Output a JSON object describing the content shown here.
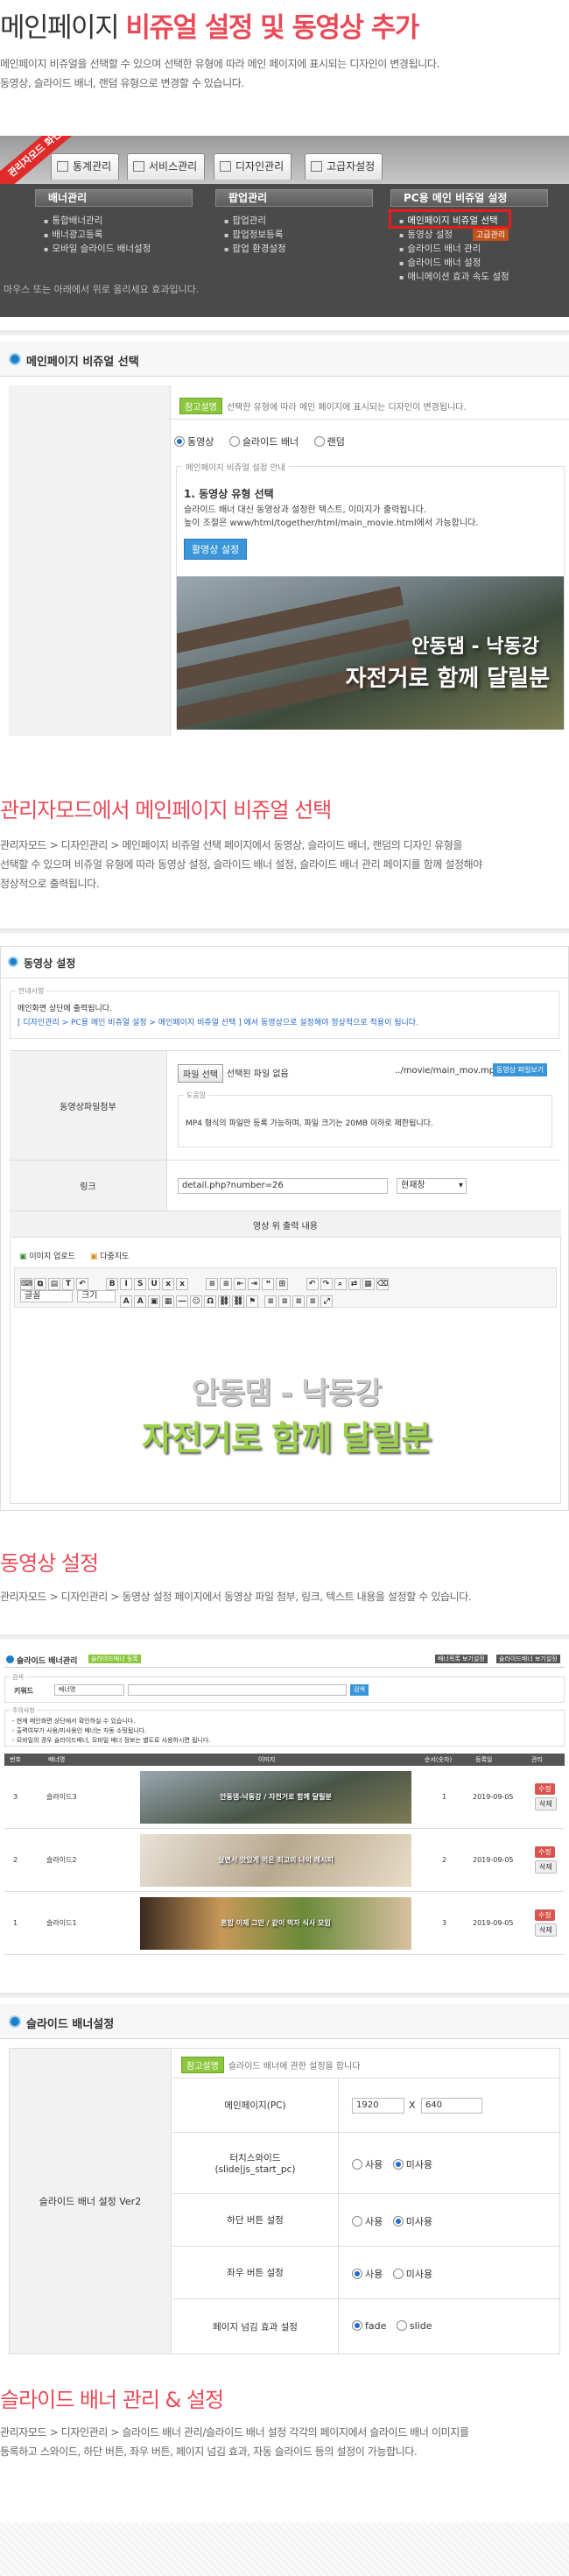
{
  "header": {
    "title_a": "메인페이지 ",
    "title_b": "비쥬얼 설정 및 동영상 추가",
    "desc1": "메인페이지 비쥬얼을 선택할 수 있으며 선택한 유형에 따라 메인 페이지에 표시되는 디자인이 변경됩니다.",
    "desc2": "동영상, 슬라이드 배너, 랜덤 유형으로 변경할 수 있습니다."
  },
  "menu_shot": {
    "badge": "관리자모드 화면",
    "tabs": [
      "통계관리",
      "서비스관리",
      "디자인관리",
      "고급자설정"
    ],
    "cols": [
      {
        "head": "배너관리",
        "items": [
          "통합배너관리",
          "배너광고등록",
          "모바일 슬라이드 배너설정"
        ]
      },
      {
        "head": "팝업관리",
        "items": [
          "팝업관리",
          "팝업정보등록",
          "팝업 환경설정"
        ]
      },
      {
        "head": "PC용 메인 비쥬얼 설정",
        "items": [
          "메인페이지 비쥬얼 선택",
          "동영상 설정",
          "슬라이드 배너 관리",
          "슬라이드 배너 설정",
          "애니메이션 효과 속도 설정"
        ]
      }
    ],
    "footer": "마우스 또는 아래에서 위로 올리세요 효과입니다.",
    "right_tag": "고급관리"
  },
  "visual_panel": {
    "head": "메인페이지 비쥬얼 선택",
    "tag": "참고설명",
    "tag_text": "선택한 유형에 따라 메인 페이지에 표시되는 디자인이 변경됩니다.",
    "options": [
      "동영상",
      "슬라이드 배너",
      "랜덤"
    ],
    "guide_legend": "메인페이지 비쥬얼 설정 안내",
    "guide_title": "1. 동영상 유형 선택",
    "guide_line1": "슬라이드 배너 대신 동영상과 설정한 텍스트, 이미지가 출력됩니다.",
    "guide_line2": "높이 조절은 www/html/together/html/main_movie.html에서 가능합니다.",
    "button": "활영상 설정",
    "banner_cap1": "안동댐 - 낙동강",
    "banner_cap2": "자전거로 함께 달릴분"
  },
  "sec1": {
    "title": "관리자모드에서 메인페이지 비쥬얼 선택",
    "desc1": "관리자모드 > 디자인관리 > 메인페이지 비쥬얼 선택 페이지에서 동영상, 슬라이드 배너, 랜덤의 디자인 유형을",
    "desc2": "선택할 수 있으며 비쥬얼 유형에 따라 동영상 설정, 슬라이드 배너 설정, 슬라이드 배너 관리 페이지를 함께 설정해야",
    "desc3": "정상적으로 출력됩니다."
  },
  "video_panel": {
    "head": "동영상 설정",
    "notice_legend": "안내사항",
    "notice1": "메인화면 상단에 출력됩니다.",
    "notice2": "[ 디자인관리 > PC용 메인 비쥬얼 설정 > 메인페이지 비쥬얼 선택 ] 에서 동영상으로 설정해야 정상적으로 적용이 됩니다.",
    "file_label": "동영상파일첨부",
    "file_btn": "파일 선택",
    "file_none": "선택된 파일 없음",
    "file_path": "../movie/main_mov.mp4",
    "file_view": "동영상 파일보기",
    "help_legend": "도움말",
    "help_text": "MP4 형식의 파일만 등록 가능하며, 파일 크기는 20MB 이하로 제한됩니다.",
    "link_label": "링크",
    "link_value": "detail.php?number=26",
    "link_target": "현재창",
    "editor_label": "영상 위 출력 내용",
    "editor_tabs": [
      "이미지 업로드",
      "다중지도"
    ],
    "font_sel": "글꼴",
    "size_sel": "크기",
    "editor_line1": "안동댐 - 낙동강",
    "editor_line2": "자전거로 함께 달릴분"
  },
  "sec2": {
    "title": "동영상 설정",
    "desc1": "관리자모드 > 디자인관리 > 동영상 설정 페이지에서 동영상 파일 첨부, 링크, 텍스트 내용을 설정할 수 있습니다."
  },
  "slide_list": {
    "head": "슬라이드 배너관리",
    "head_tag": "슬라이드배너 등록",
    "top_btns": [
      "배너목록 보기설정",
      "슬라이드배너 보기설정"
    ],
    "search_legend": "검색",
    "search_label": "키워드",
    "search_select": "배너명",
    "search_btn": "검색",
    "notice_legend": "주의사항",
    "notice1": "- 현재 메인화면 상단에서 확인하실 수 있습니다.",
    "notice2": "- 출력여부가 사용/미사용인 배너는 자동 소팅됩니다.",
    "notice3": "- 모바일의 경우 슬라이드배너, 모바일 배너 정보는 별도로 사용하시면 됩니다.",
    "cols": [
      "번호",
      "배너명",
      "이미지",
      "순서(숫자)",
      "등록일",
      "관리"
    ],
    "rows": [
      {
        "no": "3",
        "name": "슬라이드3",
        "cap": "안동댐-낙동강 / 자전거로 함께 달릴분",
        "order": "1",
        "date": "2019-09-05"
      },
      {
        "no": "2",
        "name": "슬라이드2",
        "cap": "살면서 맛있게 먹은 최고의 나의 레시피",
        "order": "2",
        "date": "2019-09-05"
      },
      {
        "no": "1",
        "name": "슬라이드1",
        "cap": "혼밥 이제 그만 / 같이 먹자 식사 모임",
        "order": "3",
        "date": "2019-09-05"
      }
    ],
    "edit": "수정",
    "del": "삭제"
  },
  "slide_setting": {
    "head": "슬라이드 배너설정",
    "tag": "참고설명",
    "tag_text": "슬라이드 배너에 관한 설정을 합니다",
    "group_label": "슬라이드 배너 설정 Ver2",
    "rows": [
      {
        "label": "메인페이지(PC)",
        "w": "1920",
        "x": "X",
        "h": "640"
      },
      {
        "label": "터치스와이드 (slide|js_start_pc)",
        "opt_on": "사용",
        "opt_off": "미사용"
      },
      {
        "label": "하단 버튼 설정",
        "opt_on": "사용",
        "opt_off": "미사용"
      },
      {
        "label": "좌우 버튼 설정",
        "opt_on": "사용",
        "opt_off": "미사용"
      },
      {
        "label": "페이지 넘김 효과 설정",
        "opt_on": "fade",
        "opt_off": "slide"
      }
    ]
  },
  "sec3": {
    "title": "슬라이드 배너 관리 & 설정",
    "desc1": "관리자모드 > 디자인관리 > 슬라이드 배너 관리/슬라이드 배너 설정 각각의 페이지에서 슬라이드 배너 이미지를",
    "desc2": "등록하고 스와이드, 하단 버튼, 좌우 버튼, 페이지 넘김 효과, 자동 슬라이드 등의 설정이 가능합니다."
  }
}
